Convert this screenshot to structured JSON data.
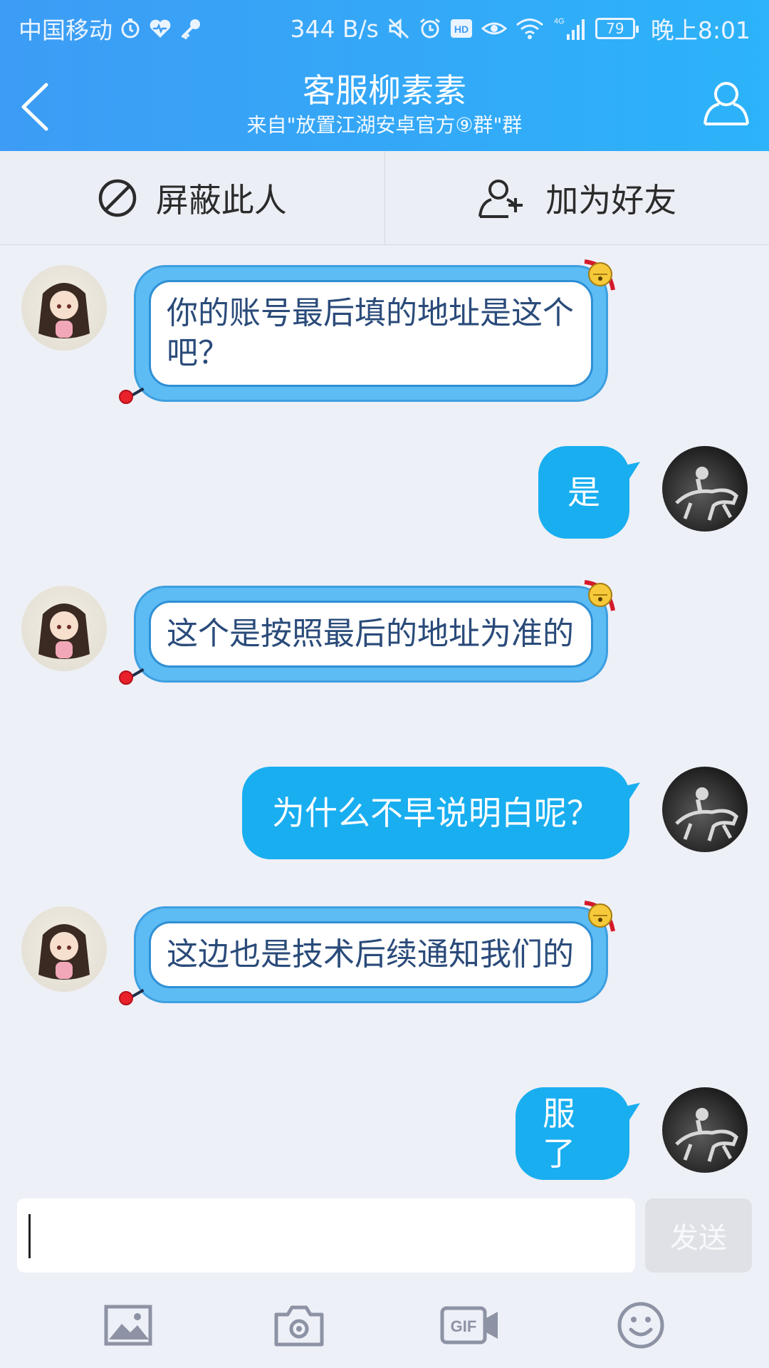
{
  "status_bar": {
    "carrier": "中国移动",
    "net_speed": "344 B/s",
    "network_label": "4G",
    "battery_level": "79",
    "time": "晚上8:01"
  },
  "header": {
    "title": "客服柳素素",
    "subtitle": "来自\"放置江湖安卓官方⑨群\"群"
  },
  "actions": {
    "block_label": "屏蔽此人",
    "add_friend_label": "加为好友"
  },
  "messages": [
    {
      "direction": "incoming",
      "text": "你的账号最后填的地址是这个吧？"
    },
    {
      "direction": "outgoing",
      "text": "是"
    },
    {
      "direction": "incoming",
      "text": "这个是按照最后的地址为准的"
    },
    {
      "direction": "outgoing",
      "text": "为什么不早说明白呢？"
    },
    {
      "direction": "incoming",
      "text": "这边也是技术后续通知我们的"
    },
    {
      "direction": "outgoing",
      "text": "服了"
    }
  ],
  "composer": {
    "input_value": "",
    "send_label": "发送"
  },
  "toolbar": {
    "items": [
      "image-icon",
      "camera-icon",
      "gif-icon",
      "emoji-icon"
    ]
  },
  "colors": {
    "header_start": "#3d9cf5",
    "header_end": "#2cb3f9",
    "outgoing_bubble": "#19aef0",
    "incoming_bubble_frame": "#5cbcf3",
    "incoming_text": "#2a4b7a"
  }
}
